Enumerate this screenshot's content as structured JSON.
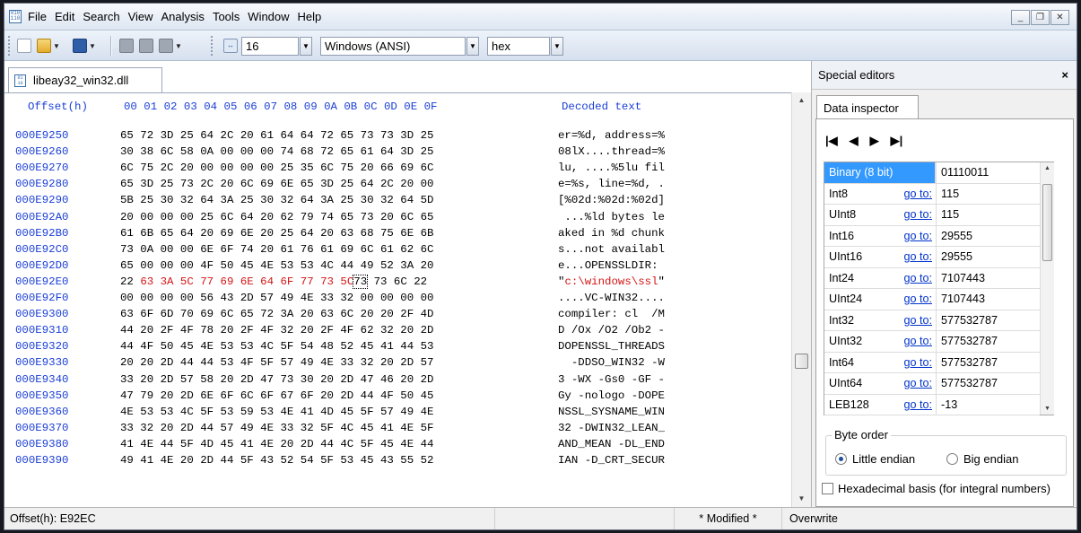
{
  "menu": [
    "File",
    "Edit",
    "Search",
    "View",
    "Analysis",
    "Tools",
    "Window",
    "Help"
  ],
  "window_buttons": {
    "minimize": "_",
    "restore": "❐",
    "close": "✕"
  },
  "toolbar": {
    "icons": [
      "new-file-icon",
      "open-folder-icon",
      "save-icon",
      "print-icon",
      "database-icon",
      "memory-icon",
      "columns-icon"
    ],
    "columns_value": "16",
    "encoding": "Windows (ANSI)",
    "numbase": "hex"
  },
  "doc_tab": {
    "label": "libeay32_win32.dll"
  },
  "hex": {
    "header_offset": "Offset(h)",
    "header_bytes": "00 01 02 03 04 05 06 07 08 09 0A 0B 0C 0D 0E 0F",
    "header_decoded": "Decoded text",
    "rows": [
      {
        "offset": "000E9250",
        "bytes": "65 72 3D 25 64 2C 20 61 64 64 72 65 73 73 3D 25",
        "text": "er=%d, address=%"
      },
      {
        "offset": "000E9260",
        "bytes": "30 38 6C 58 0A 00 00 00 74 68 72 65 61 64 3D 25",
        "text": "08lX....thread=%"
      },
      {
        "offset": "000E9270",
        "bytes": "6C 75 2C 20 00 00 00 00 25 35 6C 75 20 66 69 6C",
        "text": "lu, ....%5lu fil"
      },
      {
        "offset": "000E9280",
        "bytes": "65 3D 25 73 2C 20 6C 69 6E 65 3D 25 64 2C 20 00",
        "text": "e=%s, line=%d, ."
      },
      {
        "offset": "000E9290",
        "bytes": "5B 25 30 32 64 3A 25 30 32 64 3A 25 30 32 64 5D",
        "text": "[%02d:%02d:%02d]"
      },
      {
        "offset": "000E92A0",
        "bytes": "20 00 00 00 25 6C 64 20 62 79 74 65 73 20 6C 65",
        "text": " ...%ld bytes le"
      },
      {
        "offset": "000E92B0",
        "bytes": "61 6B 65 64 20 69 6E 20 25 64 20 63 68 75 6E 6B",
        "text": "aked in %d chunk"
      },
      {
        "offset": "000E92C0",
        "bytes": "73 0A 00 00 6E 6F 74 20 61 76 61 69 6C 61 62 6C",
        "text": "s...not availabl"
      },
      {
        "offset": "000E92D0",
        "bytes": "65 00 00 00 4F 50 45 4E 53 53 4C 44 49 52 3A 20",
        "text": "e...OPENSSLDIR: "
      },
      {
        "offset": "000E92E0",
        "bytes_pre": "22 ",
        "bytes_hi": "63 3A 5C 77 69 6E 64 6F 77 73 5C",
        "bytes_cur": "73",
        "bytes_post": " 73 6C 22",
        "text_pre": "\"",
        "text_hi": "c:\\windows\\ssl",
        "text_post": "\""
      },
      {
        "offset": "000E92F0",
        "bytes": "00 00 00 00 56 43 2D 57 49 4E 33 32 00 00 00 00",
        "text": "....VC-WIN32...."
      },
      {
        "offset": "000E9300",
        "bytes": "63 6F 6D 70 69 6C 65 72 3A 20 63 6C 20 20 2F 4D",
        "text": "compiler: cl  /M"
      },
      {
        "offset": "000E9310",
        "bytes": "44 20 2F 4F 78 20 2F 4F 32 20 2F 4F 62 32 20 2D",
        "text": "D /Ox /O2 /Ob2 -"
      },
      {
        "offset": "000E9320",
        "bytes": "44 4F 50 45 4E 53 53 4C 5F 54 48 52 45 41 44 53",
        "text": "DOPENSSL_THREADS"
      },
      {
        "offset": "000E9330",
        "bytes": "20 20 2D 44 44 53 4F 5F 57 49 4E 33 32 20 2D 57",
        "text": "  -DDSO_WIN32 -W"
      },
      {
        "offset": "000E9340",
        "bytes": "33 20 2D 57 58 20 2D 47 73 30 20 2D 47 46 20 2D",
        "text": "3 -WX -Gs0 -GF -"
      },
      {
        "offset": "000E9350",
        "bytes": "47 79 20 2D 6E 6F 6C 6F 67 6F 20 2D 44 4F 50 45",
        "text": "Gy -nologo -DOPE"
      },
      {
        "offset": "000E9360",
        "bytes": "4E 53 53 4C 5F 53 59 53 4E 41 4D 45 5F 57 49 4E",
        "text": "NSSL_SYSNAME_WIN"
      },
      {
        "offset": "000E9370",
        "bytes": "33 32 20 2D 44 57 49 4E 33 32 5F 4C 45 41 4E 5F",
        "text": "32 -DWIN32_LEAN_"
      },
      {
        "offset": "000E9380",
        "bytes": "41 4E 44 5F 4D 45 41 4E 20 2D 44 4C 5F 45 4E 44",
        "text": "AND_MEAN -DL_END"
      },
      {
        "offset": "000E9390",
        "bytes": "49 41 4E 20 2D 44 5F 43 52 54 5F 53 45 43 55 52",
        "text": "IAN -D_CRT_SECUR"
      }
    ]
  },
  "special_editors": {
    "title": "Special editors",
    "close": "×",
    "tab": "Data inspector",
    "nav": [
      "|◀",
      "◀",
      "▶",
      "▶|"
    ],
    "selected_index": 0,
    "goto_label": "go to:",
    "rows": [
      {
        "name": "Binary (8 bit)",
        "goto": false,
        "value": "01110011"
      },
      {
        "name": "Int8",
        "goto": true,
        "value": "115"
      },
      {
        "name": "UInt8",
        "goto": true,
        "value": "115"
      },
      {
        "name": "Int16",
        "goto": true,
        "value": "29555"
      },
      {
        "name": "UInt16",
        "goto": true,
        "value": "29555"
      },
      {
        "name": "Int24",
        "goto": true,
        "value": "7107443"
      },
      {
        "name": "UInt24",
        "goto": true,
        "value": "7107443"
      },
      {
        "name": "Int32",
        "goto": true,
        "value": "577532787"
      },
      {
        "name": "UInt32",
        "goto": true,
        "value": "577532787"
      },
      {
        "name": "Int64",
        "goto": true,
        "value": "577532787"
      },
      {
        "name": "UInt64",
        "goto": true,
        "value": "577532787"
      },
      {
        "name": "LEB128",
        "goto": true,
        "value": "-13"
      }
    ],
    "byte_order_label": "Byte order",
    "little_endian": "Little endian",
    "big_endian": "Big endian",
    "selected_byte_order": "little",
    "hex_basis": "Hexadecimal basis (for integral numbers)",
    "hex_basis_checked": false
  },
  "status": {
    "offset": "Offset(h): E92EC",
    "modified": "* Modified *",
    "mode": "Overwrite"
  }
}
